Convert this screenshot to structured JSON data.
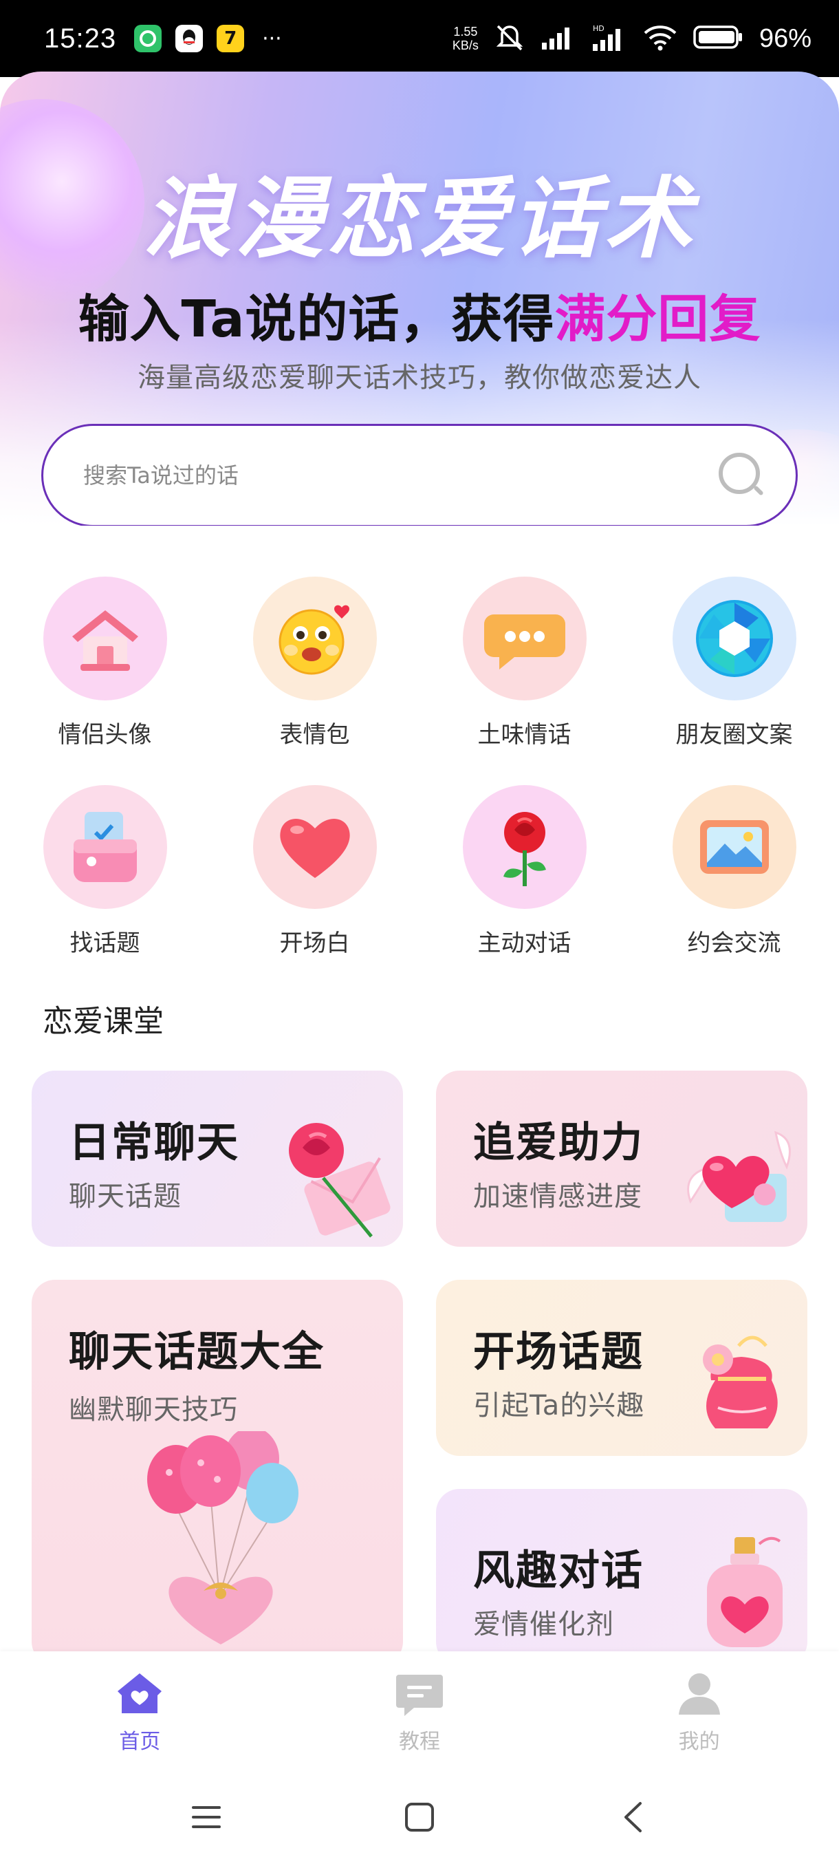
{
  "status_bar": {
    "time": "15:23",
    "app_icons": [
      "wechat-icon",
      "qq-icon",
      "app-7-icon"
    ],
    "more": "···",
    "net_speed_value": "1.55",
    "net_speed_unit": "KB/s",
    "battery": "96%"
  },
  "hero": {
    "title": "浪漫恋爱话术",
    "subtitle_prefix": "输入Ta说的话，获得",
    "subtitle_highlight": "满分回复",
    "description": "海量高级恋爱聊天话术技巧，教你做恋爱达人",
    "highlight_color": "#e21cc8"
  },
  "search": {
    "placeholder": "搜索Ta说过的话"
  },
  "categories": [
    {
      "label": "情侣头像",
      "icon": "house-icon"
    },
    {
      "label": "表情包",
      "icon": "emoji-face-icon"
    },
    {
      "label": "土味情话",
      "icon": "chat-bubble-icon"
    },
    {
      "label": "朋友圈文案",
      "icon": "camera-shutter-icon"
    },
    {
      "label": "找话题",
      "icon": "wallet-icon"
    },
    {
      "label": "开场白",
      "icon": "heart-icon"
    },
    {
      "label": "主动对话",
      "icon": "rose-icon"
    },
    {
      "label": "约会交流",
      "icon": "picture-frame-icon"
    }
  ],
  "section": {
    "title": "恋爱课堂"
  },
  "cards": [
    {
      "title": "日常聊天",
      "subtitle": "聊天话题",
      "icon": "rose-envelope-icon"
    },
    {
      "title": "追爱助力",
      "subtitle": "加速情感进度",
      "icon": "winged-heart-icon"
    },
    {
      "title": "聊天话题大全",
      "subtitle": "幽默聊天技巧",
      "icon": "heart-balloons-icon"
    },
    {
      "title": "开场话题",
      "subtitle": "引起Ta的兴趣",
      "icon": "flower-pouch-icon"
    },
    {
      "title": "风趣对话",
      "subtitle": "爱情催化剂",
      "icon": "heart-perfume-icon"
    }
  ],
  "bottom_nav": [
    {
      "label": "首页",
      "icon": "home-icon",
      "active": true
    },
    {
      "label": "教程",
      "icon": "tutorial-icon",
      "active": false
    },
    {
      "label": "我的",
      "icon": "profile-icon",
      "active": false
    }
  ],
  "colors": {
    "accent": "#6b5ce6",
    "search_border": "#6a2fb8"
  }
}
